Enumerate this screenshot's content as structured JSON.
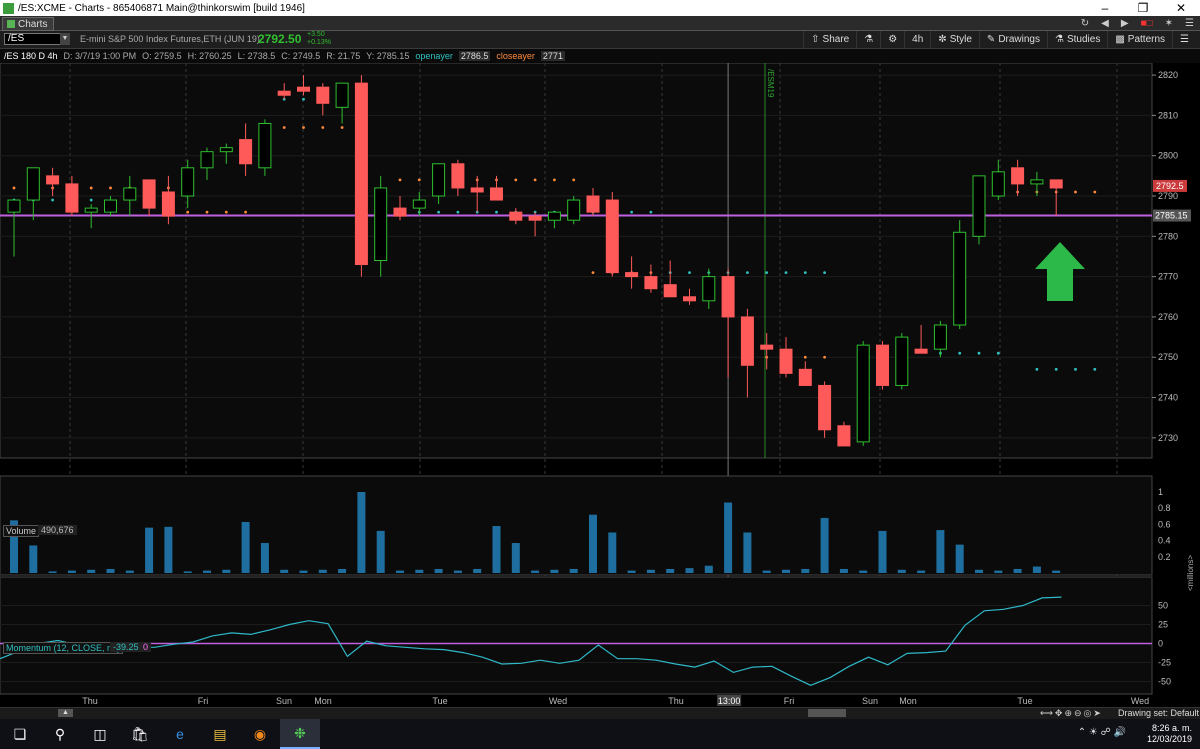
{
  "window": {
    "title": "/ES:XCME - Charts - 865406871 Main@thinkorswim [build 1946]"
  },
  "menu": {
    "tab": "Charts"
  },
  "toolbar": {
    "symbol": "/ES",
    "name": "E-mini S&P 500 Index Futures,ETH (JUN 19)",
    "last": "2792.50",
    "change": "+3.50",
    "change_pct": "+0.13%",
    "share": "Share",
    "period": "4h",
    "style": "Style",
    "drawings": "Drawings",
    "studies": "Studies",
    "patterns": "Patterns"
  },
  "studybar": {
    "ticker": "/ES 180 D 4h",
    "date": "D: 3/7/19 1:00 PM",
    "open": "O: 2759.5",
    "high": "H: 2760.25",
    "low": "L: 2738.5",
    "close": "C: 2749.5",
    "range": "R: 21.75",
    "y": "Y: 2785.15",
    "openayer_label": "openayer",
    "openayer_val": "2786.5",
    "closeayer_label": "closeayer",
    "closeayer_val": "2771"
  },
  "price_axis": {
    "ticks": [
      "2820",
      "2810",
      "2800",
      "2790",
      "2780",
      "2770",
      "2760",
      "2750",
      "2740",
      "2730"
    ],
    "last_badge": "2792.5",
    "line_badge": "2785.15"
  },
  "volume": {
    "label": "Volume",
    "value": "490,676",
    "ticks": [
      "1",
      "0.8",
      "0.6",
      "0.4",
      "0.2"
    ],
    "units": "<millions>"
  },
  "momentum": {
    "label": "Momentum (12, CLOSE, no)",
    "value": "-39.25",
    "zero_label": "0",
    "ticks": [
      "50",
      "25",
      "0",
      "-25",
      "-50"
    ]
  },
  "time_axis": {
    "labels": [
      "Thu",
      "Fri",
      "Sun",
      "Mon",
      "Tue",
      "Wed",
      "Thu",
      "Fri",
      "Sun",
      "Mon",
      "Tue",
      "Wed"
    ],
    "cursor": "13:00"
  },
  "cursor_marker": "/ESM19",
  "statusbar": {
    "drawing_set": "Drawing set: Default"
  },
  "clock": {
    "time": "8:26 a. m.",
    "date": "12/03/2019"
  },
  "colors": {
    "up": "#2fbf2f",
    "down": "#ff5a5a",
    "open_dots": "#2fc0c0",
    "close_dots": "#ff8a3c",
    "hline": "#c060e0",
    "volume": "#1e6fa0",
    "momentum": "#2fb8c8"
  },
  "chart_data": {
    "type": "candlestick",
    "ylim": [
      2725,
      2823
    ],
    "candles": [
      [
        2786,
        2789,
        2775,
        2789
      ],
      [
        2789,
        2797,
        2784,
        2797
      ],
      [
        2795,
        2797,
        2790,
        2793
      ],
      [
        2793,
        2795,
        2785,
        2786
      ],
      [
        2786,
        2788,
        2782,
        2787
      ],
      [
        2786,
        2790,
        2785,
        2789
      ],
      [
        2789,
        2795,
        2785,
        2792
      ],
      [
        2794,
        2794,
        2785,
        2787
      ],
      [
        2791,
        2795,
        2783,
        2785
      ],
      [
        2790,
        2799,
        2787,
        2797
      ],
      [
        2797,
        2802,
        2794,
        2801
      ],
      [
        2801,
        2803,
        2798,
        2802
      ],
      [
        2804,
        2808,
        2795,
        2798
      ],
      [
        2797,
        2809,
        2795,
        2808
      ],
      [
        2816,
        2818,
        2814,
        2815
      ],
      [
        2817,
        2820,
        2815,
        2816
      ],
      [
        2817,
        2818,
        2810,
        2813
      ],
      [
        2812,
        2818,
        2808,
        2818
      ],
      [
        2818,
        2820,
        2770,
        2773
      ],
      [
        2774,
        2795,
        2770,
        2792
      ],
      [
        2787,
        2790,
        2784,
        2785
      ],
      [
        2787,
        2791,
        2785,
        2789
      ],
      [
        2790,
        2798,
        2788,
        2798
      ],
      [
        2798,
        2799,
        2790,
        2792
      ],
      [
        2792,
        2795,
        2786,
        2791
      ],
      [
        2792,
        2795,
        2789,
        2789
      ],
      [
        2786,
        2787,
        2783,
        2784
      ],
      [
        2785,
        2786,
        2780,
        2784
      ],
      [
        2784,
        2785,
        2782,
        2786
      ],
      [
        2784,
        2790,
        2783,
        2789
      ],
      [
        2790,
        2792,
        2785,
        2786
      ],
      [
        2789,
        2791,
        2770,
        2771
      ],
      [
        2771,
        2775,
        2767,
        2770
      ],
      [
        2770,
        2773,
        2766,
        2767
      ],
      [
        2768,
        2774,
        2765,
        2765
      ],
      [
        2765,
        2767,
        2763,
        2764
      ],
      [
        2764,
        2772,
        2762,
        2770
      ],
      [
        2770,
        2772,
        2745,
        2760
      ],
      [
        2760,
        2762,
        2740,
        2748
      ],
      [
        2753,
        2756,
        2747,
        2752
      ],
      [
        2752,
        2755,
        2745,
        2746
      ],
      [
        2747,
        2749,
        2743,
        2743
      ],
      [
        2743,
        2744,
        2730,
        2732
      ],
      [
        2733,
        2734,
        2728,
        2728
      ],
      [
        2729,
        2754,
        2728,
        2753
      ],
      [
        2753,
        2754,
        2742,
        2743
      ],
      [
        2743,
        2756,
        2742,
        2755
      ],
      [
        2752,
        2758,
        2751,
        2751
      ],
      [
        2752,
        2759,
        2750,
        2758
      ],
      [
        2758,
        2784,
        2757,
        2781
      ],
      [
        2780,
        2795,
        2778,
        2795
      ],
      [
        2790,
        2799,
        2789,
        2796
      ],
      [
        2797,
        2799,
        2790,
        2793
      ],
      [
        2793,
        2796,
        2790,
        2794
      ],
      [
        2794,
        2794,
        2785,
        2792
      ]
    ],
    "volume": [
      0.65,
      0.34,
      0.02,
      0.03,
      0.04,
      0.05,
      0.03,
      0.56,
      0.57,
      0.02,
      0.03,
      0.04,
      0.63,
      0.37,
      0.04,
      0.03,
      0.04,
      0.05,
      1.0,
      0.52,
      0.03,
      0.04,
      0.05,
      0.03,
      0.05,
      0.58,
      0.37,
      0.03,
      0.04,
      0.05,
      0.72,
      0.5,
      0.03,
      0.04,
      0.05,
      0.06,
      0.09,
      0.87,
      0.5,
      0.03,
      0.04,
      0.05,
      0.68,
      0.05,
      0.03,
      0.52,
      0.04,
      0.03,
      0.53,
      0.35,
      0.04,
      0.03,
      0.05,
      0.08,
      0.03
    ],
    "momentum": [
      -20,
      -10,
      0,
      4,
      -2,
      -5,
      -3,
      -5,
      -5,
      -1,
      2,
      10,
      14,
      12,
      18,
      25,
      30,
      26,
      -17,
      3,
      -3,
      -5,
      -7,
      -8,
      -12,
      -18,
      -27,
      -26,
      -22,
      -26,
      -22,
      -2,
      -20,
      -20,
      -22,
      -27,
      -31,
      -23,
      -38,
      -31,
      -30,
      -43,
      -55,
      -45,
      -30,
      -18,
      -28,
      -13,
      -12,
      -10,
      24,
      43,
      45,
      50,
      60,
      61
    ],
    "open_dots": [
      [
        0,
        4,
        2789
      ],
      [
        14,
        18,
        2814
      ],
      [
        20,
        29,
        2786
      ],
      [
        30,
        33,
        2786
      ],
      [
        34,
        37,
        2771
      ],
      [
        38,
        42,
        2771
      ],
      [
        48,
        51,
        2751
      ],
      [
        53,
        56,
        2747
      ]
    ],
    "close_dots": [
      [
        0,
        8,
        2792
      ],
      [
        8,
        12,
        2786
      ],
      [
        14,
        18,
        2807
      ],
      [
        20,
        29,
        2794
      ],
      [
        30,
        33,
        2771
      ],
      [
        38,
        42,
        2750
      ],
      [
        50,
        56,
        2791
      ]
    ],
    "hline": 2785.15,
    "cursor_index": 37
  }
}
